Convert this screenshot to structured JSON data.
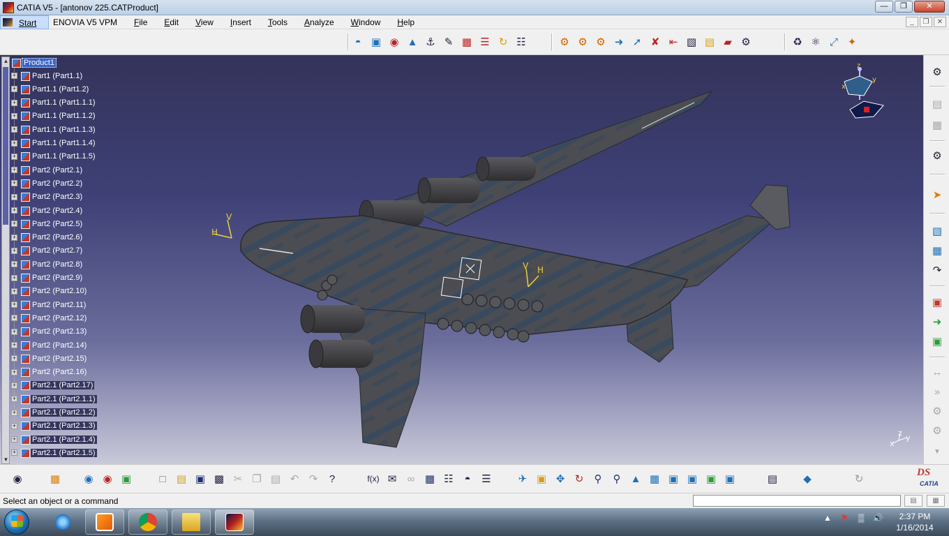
{
  "window": {
    "title": "CATIA V5 - [antonov 225.CATProduct]",
    "minimize_icon": "minimize-icon",
    "restore_icon": "restore-icon",
    "close_icon": "close-icon"
  },
  "menu": {
    "start": "Start",
    "items": [
      "ENOVIA V5 VPM",
      "File",
      "Edit",
      "View",
      "Insert",
      "Tools",
      "Analyze",
      "Window",
      "Help"
    ]
  },
  "spec_tree": {
    "root": "Product1",
    "items": [
      "Part1 (Part1.1)",
      "Part1.1 (Part1.2)",
      "Part1.1 (Part1.1.1)",
      "Part1.1 (Part1.1.2)",
      "Part1.1 (Part1.1.3)",
      "Part1.1 (Part1.1.4)",
      "Part1.1 (Part1.1.5)",
      "Part2 (Part2.1)",
      "Part2 (Part2.2)",
      "Part2 (Part2.3)",
      "Part2 (Part2.4)",
      "Part2 (Part2.5)",
      "Part2 (Part2.6)",
      "Part2 (Part2.7)",
      "Part2 (Part2.8)",
      "Part2 (Part2.9)",
      "Part2 (Part2.10)",
      "Part2 (Part2.11)",
      "Part2 (Part2.12)",
      "Part2 (Part2.13)",
      "Part2 (Part2.14)",
      "Part2 (Part2.15)",
      "Part2 (Part2.16)",
      "Part2.1 (Part2.17)",
      "Part2.1 (Part2.1.1)",
      "Part2.1 (Part2.1.2)",
      "Part2.1 (Part2.1.3)",
      "Part2.1 (Part2.1.4)",
      "Part2.1 (Part2.1.5)"
    ],
    "highlighted_from": 23
  },
  "compass": {
    "z": "z",
    "x": "x",
    "y": "y"
  },
  "viewport": {
    "axis_left": {
      "v": "V",
      "h": "H"
    },
    "axis_body": {
      "v": "V",
      "h": "H"
    },
    "axis_corner": {
      "x": "x",
      "y": "y",
      "z": "z"
    }
  },
  "status": {
    "message": "Select an object or a command",
    "command_input": "",
    "btn1_icon": "panel-icon",
    "btn2_icon": "panel-icon-2"
  },
  "taskbar": {
    "apps": [
      "internet-explorer-icon",
      "media-player-icon",
      "chrome-icon",
      "file-explorer-icon",
      "catia-icon"
    ],
    "time": "2:37 PM",
    "date": "1/16/2014"
  },
  "branding": {
    "ds": "DS",
    "name": "CATIA"
  },
  "colors": {
    "viewport_top": "#33335a",
    "viewport_bottom": "#c9c9da",
    "tree_highlight": "#35355e",
    "root_selection": "#3a63c2"
  }
}
